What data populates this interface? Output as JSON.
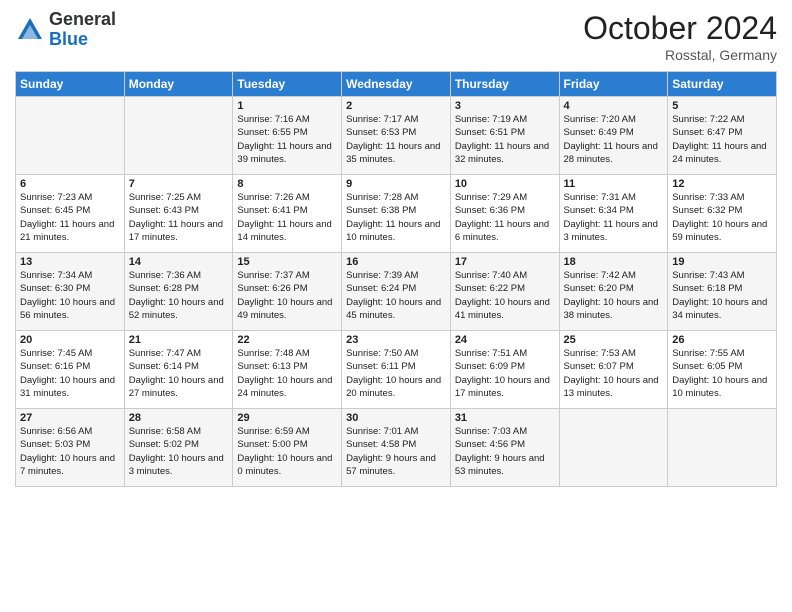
{
  "logo": {
    "general": "General",
    "blue": "Blue"
  },
  "title": "October 2024",
  "location": "Rosstal, Germany",
  "days_header": [
    "Sunday",
    "Monday",
    "Tuesday",
    "Wednesday",
    "Thursday",
    "Friday",
    "Saturday"
  ],
  "weeks": [
    [
      {
        "day": "",
        "info": ""
      },
      {
        "day": "",
        "info": ""
      },
      {
        "day": "1",
        "info": "Sunrise: 7:16 AM\nSunset: 6:55 PM\nDaylight: 11 hours and 39 minutes."
      },
      {
        "day": "2",
        "info": "Sunrise: 7:17 AM\nSunset: 6:53 PM\nDaylight: 11 hours and 35 minutes."
      },
      {
        "day": "3",
        "info": "Sunrise: 7:19 AM\nSunset: 6:51 PM\nDaylight: 11 hours and 32 minutes."
      },
      {
        "day": "4",
        "info": "Sunrise: 7:20 AM\nSunset: 6:49 PM\nDaylight: 11 hours and 28 minutes."
      },
      {
        "day": "5",
        "info": "Sunrise: 7:22 AM\nSunset: 6:47 PM\nDaylight: 11 hours and 24 minutes."
      }
    ],
    [
      {
        "day": "6",
        "info": "Sunrise: 7:23 AM\nSunset: 6:45 PM\nDaylight: 11 hours and 21 minutes."
      },
      {
        "day": "7",
        "info": "Sunrise: 7:25 AM\nSunset: 6:43 PM\nDaylight: 11 hours and 17 minutes."
      },
      {
        "day": "8",
        "info": "Sunrise: 7:26 AM\nSunset: 6:41 PM\nDaylight: 11 hours and 14 minutes."
      },
      {
        "day": "9",
        "info": "Sunrise: 7:28 AM\nSunset: 6:38 PM\nDaylight: 11 hours and 10 minutes."
      },
      {
        "day": "10",
        "info": "Sunrise: 7:29 AM\nSunset: 6:36 PM\nDaylight: 11 hours and 6 minutes."
      },
      {
        "day": "11",
        "info": "Sunrise: 7:31 AM\nSunset: 6:34 PM\nDaylight: 11 hours and 3 minutes."
      },
      {
        "day": "12",
        "info": "Sunrise: 7:33 AM\nSunset: 6:32 PM\nDaylight: 10 hours and 59 minutes."
      }
    ],
    [
      {
        "day": "13",
        "info": "Sunrise: 7:34 AM\nSunset: 6:30 PM\nDaylight: 10 hours and 56 minutes."
      },
      {
        "day": "14",
        "info": "Sunrise: 7:36 AM\nSunset: 6:28 PM\nDaylight: 10 hours and 52 minutes."
      },
      {
        "day": "15",
        "info": "Sunrise: 7:37 AM\nSunset: 6:26 PM\nDaylight: 10 hours and 49 minutes."
      },
      {
        "day": "16",
        "info": "Sunrise: 7:39 AM\nSunset: 6:24 PM\nDaylight: 10 hours and 45 minutes."
      },
      {
        "day": "17",
        "info": "Sunrise: 7:40 AM\nSunset: 6:22 PM\nDaylight: 10 hours and 41 minutes."
      },
      {
        "day": "18",
        "info": "Sunrise: 7:42 AM\nSunset: 6:20 PM\nDaylight: 10 hours and 38 minutes."
      },
      {
        "day": "19",
        "info": "Sunrise: 7:43 AM\nSunset: 6:18 PM\nDaylight: 10 hours and 34 minutes."
      }
    ],
    [
      {
        "day": "20",
        "info": "Sunrise: 7:45 AM\nSunset: 6:16 PM\nDaylight: 10 hours and 31 minutes."
      },
      {
        "day": "21",
        "info": "Sunrise: 7:47 AM\nSunset: 6:14 PM\nDaylight: 10 hours and 27 minutes."
      },
      {
        "day": "22",
        "info": "Sunrise: 7:48 AM\nSunset: 6:13 PM\nDaylight: 10 hours and 24 minutes."
      },
      {
        "day": "23",
        "info": "Sunrise: 7:50 AM\nSunset: 6:11 PM\nDaylight: 10 hours and 20 minutes."
      },
      {
        "day": "24",
        "info": "Sunrise: 7:51 AM\nSunset: 6:09 PM\nDaylight: 10 hours and 17 minutes."
      },
      {
        "day": "25",
        "info": "Sunrise: 7:53 AM\nSunset: 6:07 PM\nDaylight: 10 hours and 13 minutes."
      },
      {
        "day": "26",
        "info": "Sunrise: 7:55 AM\nSunset: 6:05 PM\nDaylight: 10 hours and 10 minutes."
      }
    ],
    [
      {
        "day": "27",
        "info": "Sunrise: 6:56 AM\nSunset: 5:03 PM\nDaylight: 10 hours and 7 minutes."
      },
      {
        "day": "28",
        "info": "Sunrise: 6:58 AM\nSunset: 5:02 PM\nDaylight: 10 hours and 3 minutes."
      },
      {
        "day": "29",
        "info": "Sunrise: 6:59 AM\nSunset: 5:00 PM\nDaylight: 10 hours and 0 minutes."
      },
      {
        "day": "30",
        "info": "Sunrise: 7:01 AM\nSunset: 4:58 PM\nDaylight: 9 hours and 57 minutes."
      },
      {
        "day": "31",
        "info": "Sunrise: 7:03 AM\nSunset: 4:56 PM\nDaylight: 9 hours and 53 minutes."
      },
      {
        "day": "",
        "info": ""
      },
      {
        "day": "",
        "info": ""
      }
    ]
  ]
}
